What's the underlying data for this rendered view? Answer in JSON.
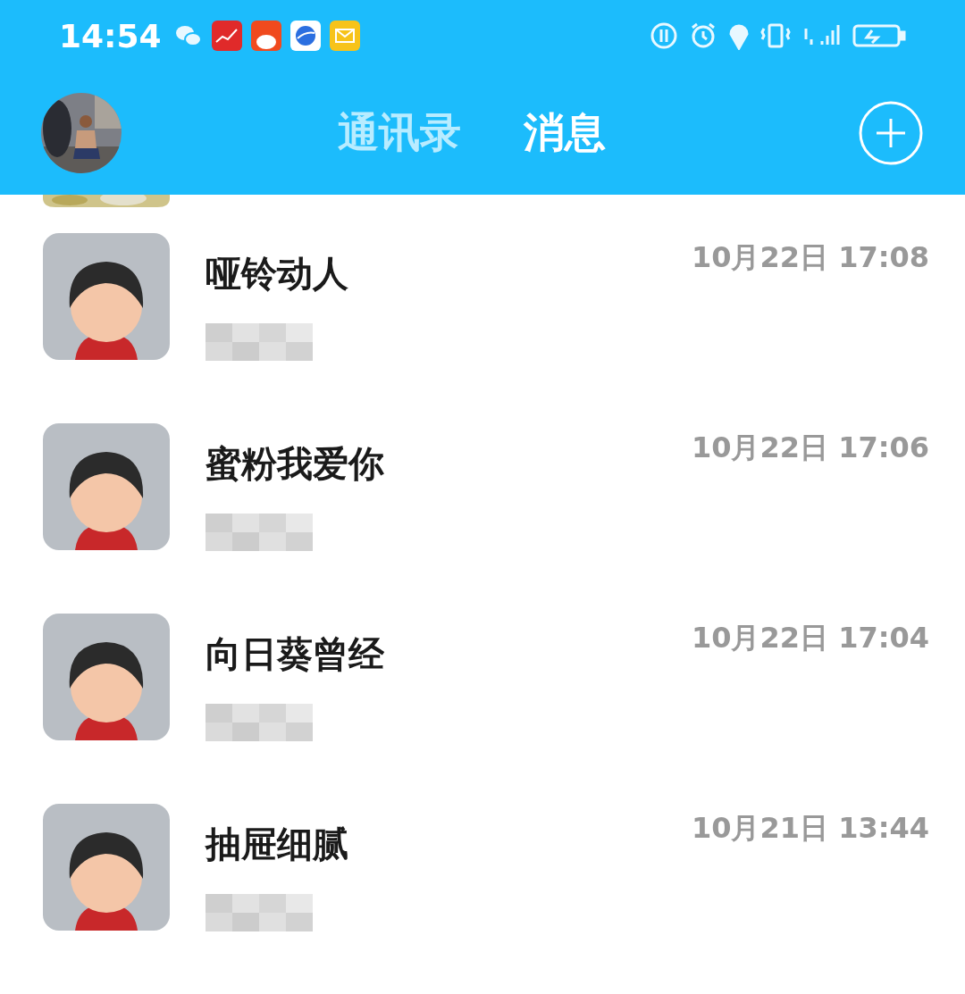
{
  "status_bar": {
    "time": "14:54"
  },
  "header": {
    "tabs": [
      {
        "label": "通讯录",
        "selected": false
      },
      {
        "label": "消息",
        "selected": true
      }
    ]
  },
  "conversations": [
    {
      "name": "哑铃动人",
      "time": "10月22日 17:08"
    },
    {
      "name": "蜜粉我爱你",
      "time": "10月22日 17:06"
    },
    {
      "name": "向日葵曾经",
      "time": "10月22日 17:04"
    },
    {
      "name": "抽屉细腻",
      "time": "10月21日 13:44"
    }
  ]
}
